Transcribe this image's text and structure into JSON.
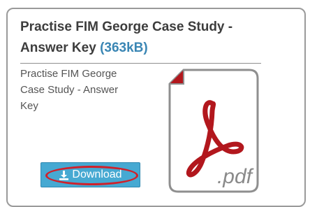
{
  "file": {
    "title": "Practise FIM George Case Study - Answer Key",
    "size": "(363kB)",
    "description": "Practise FIM George Case Study - Answer Key",
    "pdf_label": ".pdf"
  },
  "actions": {
    "download_label": "Download"
  },
  "colors": {
    "title": "#3d3d3d",
    "size_accent": "#3a86b4",
    "button_bg": "#46a9d2",
    "highlight_ring": "#d0202a",
    "pdf_red": "#b2171d"
  },
  "icons": {
    "download": "download-icon",
    "file": "pdf-file-icon"
  }
}
